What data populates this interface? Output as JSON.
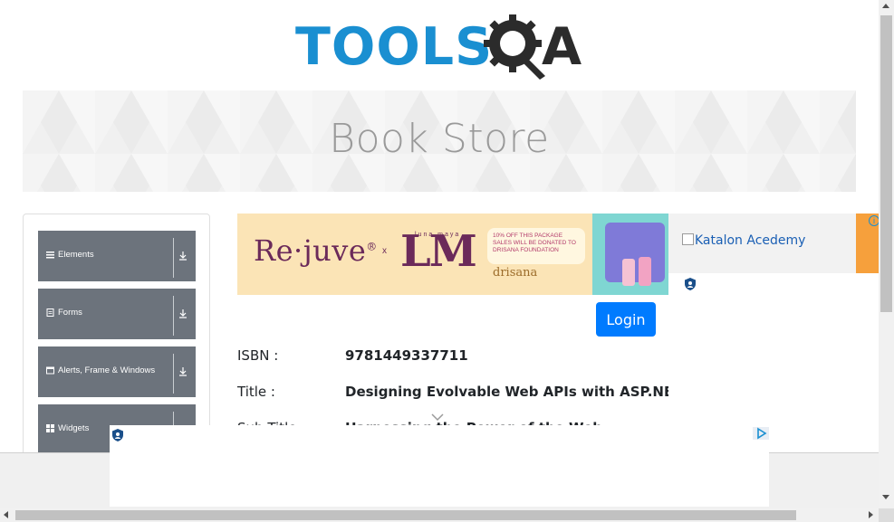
{
  "logo": {
    "text_blue": "TOOLS",
    "text_dark": "A",
    "brand_blue": "#1a8fd1",
    "brand_dark": "#2b2b2b"
  },
  "banner": {
    "title": "Book Store"
  },
  "sidebar": {
    "groups": [
      {
        "label": "Elements",
        "icon": "hamburger-icon"
      },
      {
        "label": "Forms",
        "icon": "document-icon"
      },
      {
        "label": "Alerts, Frame & Windows",
        "icon": "window-icon"
      },
      {
        "label": "Widgets",
        "icon": "grid-icon"
      }
    ]
  },
  "ad_main": {
    "brand": "Re·juve",
    "superscript": "®",
    "x": "x",
    "partner": "LM",
    "partner_sub": "luna maya",
    "note": "10% OFF THIS PACKAGE SALES WILL BE DONATED TO DRISANA FOUNDATION",
    "foundation": "drisana"
  },
  "login": {
    "label": "Login",
    "color": "#007bff"
  },
  "book": {
    "isbn_label": "ISBN :",
    "isbn_value": "9781449337711",
    "title_label": "Title :",
    "title_value": "Designing Evolvable Web APIs with ASP.NET",
    "subtitle_label": "Sub Title :",
    "subtitle_value": "Harnessing the Power of the Web"
  },
  "right_ad": {
    "alt_text": "Katalon Acedemy",
    "info": "i"
  },
  "icons": {
    "ad_shield": "shield-icon",
    "ad_choices": "adchoices-icon",
    "chevron": "chevron-down-icon"
  }
}
